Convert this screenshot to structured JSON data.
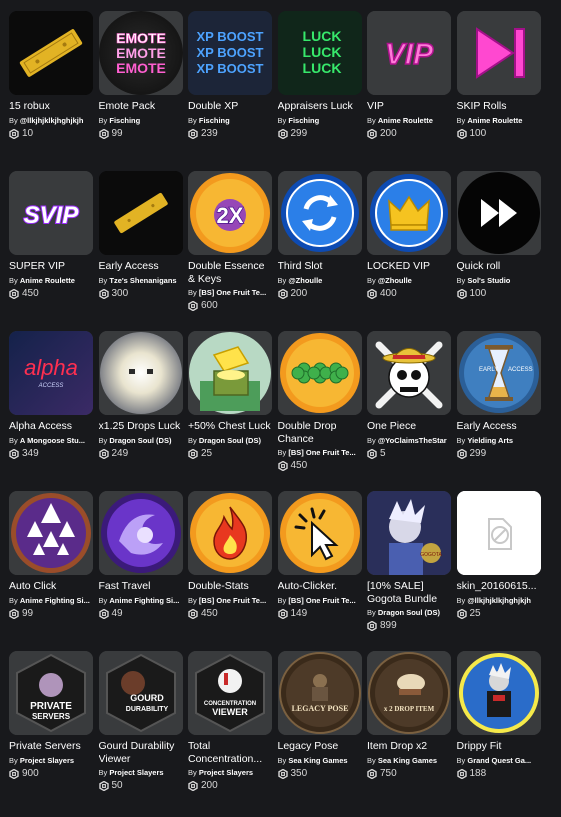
{
  "items": [
    {
      "name": "15 robux",
      "by": "By",
      "creator": "@llkjhjklkjhghjkjh",
      "price": "10",
      "icon": "gold-ticket-icon"
    },
    {
      "name": "Emote Pack",
      "by": "By",
      "creator": "Fisching",
      "price": "99",
      "icon": "emote-text-icon"
    },
    {
      "name": "Double XP",
      "by": "By",
      "creator": "Fisching",
      "price": "239",
      "icon": "xp-boost-text-icon"
    },
    {
      "name": "Appraisers Luck",
      "by": "By",
      "creator": "Fisching",
      "price": "299",
      "icon": "luck-text-icon"
    },
    {
      "name": "VIP",
      "by": "By",
      "creator": "Anime Roulette",
      "price": "200",
      "icon": "vip-text-icon"
    },
    {
      "name": "SKIP Rolls",
      "by": "By",
      "creator": "Anime Roulette",
      "price": "100",
      "icon": "skip-forward-icon"
    },
    {
      "name": "SUPER VIP",
      "by": "By",
      "creator": "Anime Roulette",
      "price": "450",
      "icon": "svip-text-icon"
    },
    {
      "name": "Early Access",
      "by": "By",
      "creator": "Tze's Shenanigans",
      "price": "300",
      "icon": "gold-ticket-icon"
    },
    {
      "name": "Double Essence & Keys",
      "by": "By",
      "creator": "[BS] One Fruit Te...",
      "price": "600",
      "icon": "2x-badge-icon"
    },
    {
      "name": "Third Slot",
      "by": "By",
      "creator": "@Zhoulle",
      "price": "200",
      "icon": "refresh-circle-icon"
    },
    {
      "name": "LOCKED VIP",
      "by": "By",
      "creator": "@Zhoulle",
      "price": "400",
      "icon": "crown-circle-icon"
    },
    {
      "name": "Quick roll",
      "by": "By",
      "creator": "Sol's Studio",
      "price": "100",
      "icon": "fast-forward-icon"
    },
    {
      "name": "Alpha Access",
      "by": "By",
      "creator": "A Mongoose Stu...",
      "price": "349",
      "icon": "alpha-text-icon"
    },
    {
      "name": "x1.25 Drops Luck",
      "by": "By",
      "creator": "Dragon Soul (DS)",
      "price": "249",
      "icon": "glowing-creature-icon"
    },
    {
      "name": "+50% Chest Luck",
      "by": "By",
      "creator": "Dragon Soul (DS)",
      "price": "25",
      "icon": "chest-icon"
    },
    {
      "name": "Double Drop Chance",
      "by": "By",
      "creator": "[BS] One Fruit Te...",
      "price": "450",
      "icon": "clover-icon"
    },
    {
      "name": "One Piece",
      "by": "By",
      "creator": "@YoClaimsTheStar",
      "price": "5",
      "icon": "skull-strawhat-icon"
    },
    {
      "name": "Early Access",
      "by": "By",
      "creator": "Yielding Arts",
      "price": "299",
      "icon": "hourglass-icon"
    },
    {
      "name": "Auto Click",
      "by": "By",
      "creator": "Anime Fighting Si...",
      "price": "99",
      "icon": "arrows-up-icon"
    },
    {
      "name": "Fast Travel",
      "by": "By",
      "creator": "Anime Fighting Si...",
      "price": "49",
      "icon": "swirl-orb-icon"
    },
    {
      "name": "Double-Stats",
      "by": "By",
      "creator": "[BS] One Fruit Te...",
      "price": "450",
      "icon": "flame-icon"
    },
    {
      "name": "Auto-Clicker.",
      "by": "By",
      "creator": "[BS] One Fruit Te...",
      "price": "149",
      "icon": "cursor-click-icon"
    },
    {
      "name": "[10% SALE] Gogota Bundle",
      "by": "By",
      "creator": "Dragon Soul (DS)",
      "price": "899",
      "icon": "anime-character-icon"
    },
    {
      "name": "skin_20160615...",
      "by": "By",
      "creator": "@llkjhjklkjhghjkjh",
      "price": "25",
      "icon": "broken-image-icon"
    },
    {
      "name": "Private Servers",
      "by": "By",
      "creator": "Project Slayers",
      "price": "900",
      "icon": "private-servers-badge-icon"
    },
    {
      "name": "Gourd Durability Viewer",
      "by": "By",
      "creator": "Project Slayers",
      "price": "50",
      "icon": "gourd-durability-badge-icon"
    },
    {
      "name": "Total Concentration...",
      "by": "By",
      "creator": "Project Slayers",
      "price": "200",
      "icon": "concentration-viewer-badge-icon"
    },
    {
      "name": "Legacy Pose",
      "by": "By",
      "creator": "Sea King Games",
      "price": "350",
      "icon": "legacy-pose-icon"
    },
    {
      "name": "Item Drop x2",
      "by": "By",
      "creator": "Sea King Games",
      "price": "750",
      "icon": "item-drop-icon"
    },
    {
      "name": "Drippy Fit",
      "by": "By",
      "creator": "Grand Quest Ga...",
      "price": "188",
      "icon": "drippy-character-icon"
    }
  ],
  "thumb_text": {
    "emote": [
      "EMOTE",
      "EMOTE",
      "EMOTE"
    ],
    "xp": [
      "XP BOOST",
      "XP BOOST",
      "XP BOOST"
    ],
    "luck": [
      "LUCK",
      "LUCK",
      "LUCK"
    ],
    "vip": "VIP",
    "svip": "SVIP",
    "x2": "2X",
    "alpha": "alpha",
    "alpha_sub": "ACCESS",
    "early": "EARLY",
    "access": "ACCESS",
    "legacy": "LEGACY POSE",
    "drop": "x 2 DROP ITEM",
    "ps1": "PRIVATE",
    "ps2": "SERVERS",
    "gd1": "GOURD",
    "gd2": "DURABILITY",
    "tc1": "CONCENTRATION",
    "tc2": "VIEWER",
    "gogota": "GOGOTA"
  },
  "colors": {
    "background": "#18191c",
    "tile": "#393b3d",
    "text": "#ffffff",
    "muted": "#d8d8d8",
    "vip_pink": "#ff48d0",
    "orange": "#f7931e",
    "blue": "#1f66d9"
  }
}
